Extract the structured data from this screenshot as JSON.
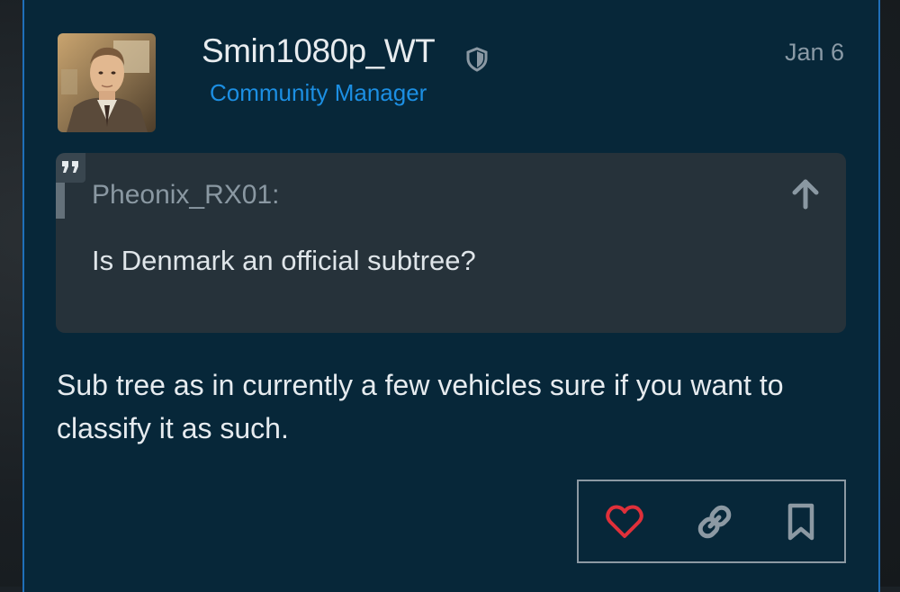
{
  "post": {
    "username": "Smin1080p_WT",
    "role": "Community Manager",
    "date": "Jan 6",
    "body": "Sub tree as in currently a few vehicles sure if you want to classify it as such."
  },
  "quote": {
    "author": "Pheonix_RX01:",
    "text": "Is Denmark an official subtree?"
  },
  "icons": {
    "shield": "shield-icon",
    "quote": "quote-icon",
    "up": "arrow-up-icon",
    "like": "heart-icon",
    "link": "link-icon",
    "bookmark": "bookmark-icon"
  },
  "colors": {
    "post_bg": "#072739",
    "accent_border": "#1f6fb8",
    "role": "#1c8fe3",
    "heart": "#e0303a",
    "icon": "#8c99a3"
  }
}
